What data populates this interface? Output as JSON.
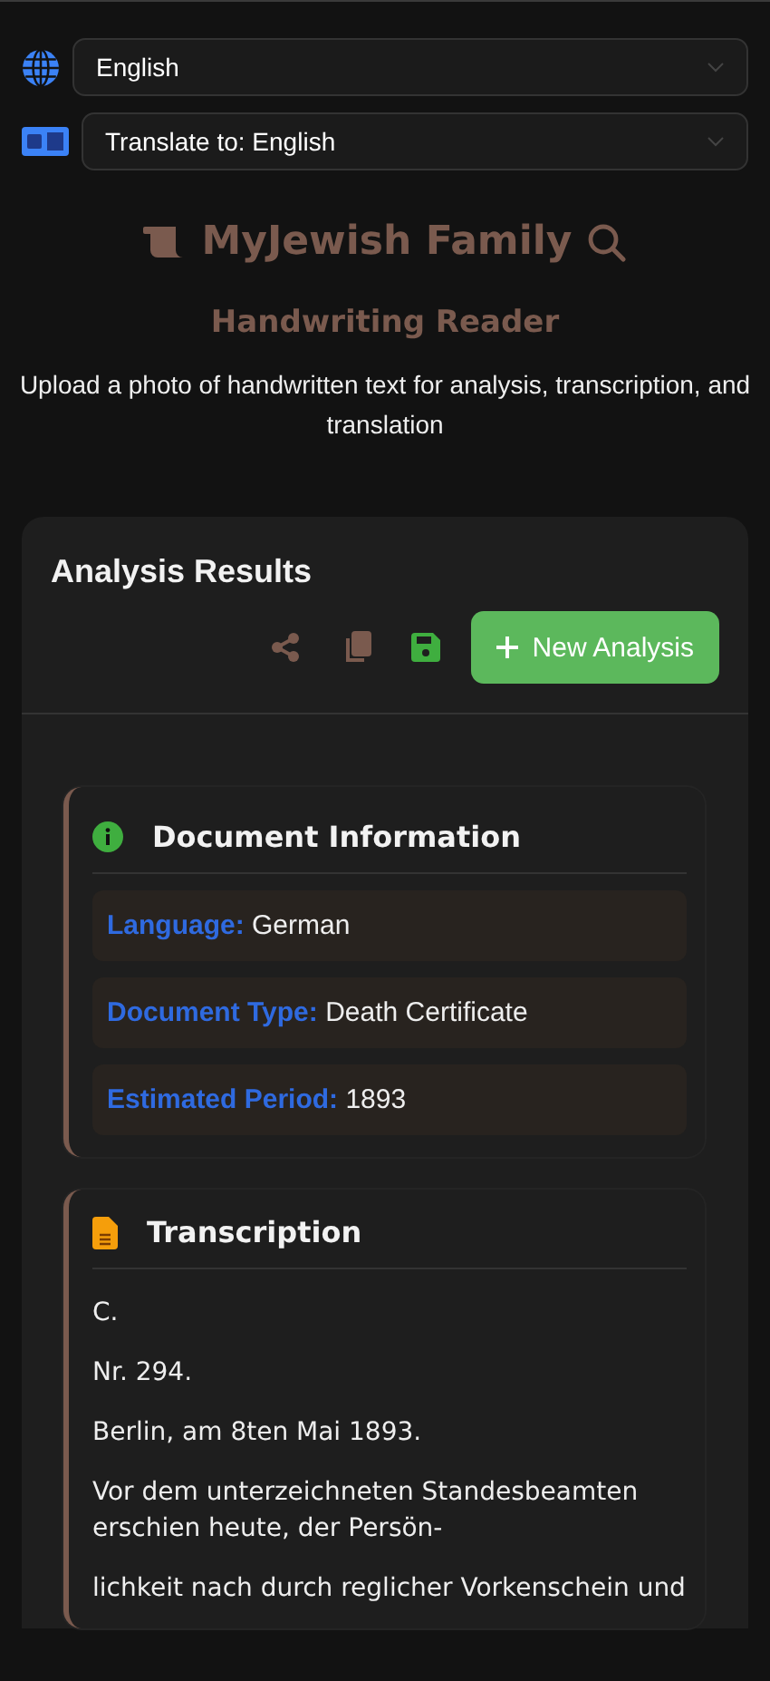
{
  "language_select": {
    "value": "English"
  },
  "translate_select": {
    "value": "Translate to: English"
  },
  "header": {
    "title": "MyJewish Family",
    "subtitle": "Handwriting Reader",
    "description": "Upload a photo of handwritten text for analysis, transcription, and translation"
  },
  "results": {
    "title": "Analysis Results",
    "new_button": "New Analysis",
    "document_information": {
      "title": "Document Information",
      "fields": [
        {
          "label": "Language:",
          "value": "German"
        },
        {
          "label": "Document Type:",
          "value": "Death Certificate"
        },
        {
          "label": "Estimated Period:",
          "value": "1893"
        }
      ]
    },
    "transcription": {
      "title": "Transcription",
      "paragraphs": [
        "C.",
        "Nr. 294.",
        "Berlin, am 8ten Mai 1893.",
        "Vor dem unterzeichneten Standesbeamten erschien heute, der Persön-",
        "lichkeit nach durch reglicher Vorkenschein und"
      ]
    }
  }
}
